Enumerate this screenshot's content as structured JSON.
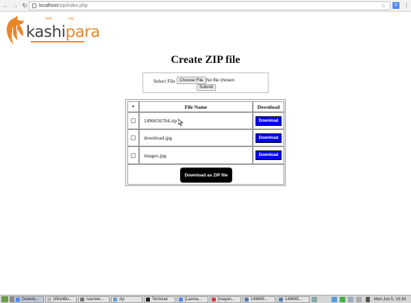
{
  "browser": {
    "url_host": "localhost",
    "url_path": "/zip/index.php"
  },
  "logo": {
    "text_main": "kashi",
    "text_accent": "para",
    "devanagari_1": "काशी",
    "devanagari_2": "पारा"
  },
  "page": {
    "title": "Create ZIP file"
  },
  "upload": {
    "label": "Select File",
    "choose_label": "Choose File",
    "no_file": "No file chosen",
    "submit_label": "Submit"
  },
  "table": {
    "headers": [
      "*",
      "File Name",
      "Download"
    ],
    "rows": [
      {
        "name": "1496656784.zip",
        "button": "Download"
      },
      {
        "name": "download.jpg",
        "button": "Download"
      },
      {
        "name": "images.jpg",
        "button": "Download"
      }
    ],
    "zip_button": "Download as ZIP file"
  },
  "taskbar": {
    "items": [
      "Downlo...",
      "[WishBo...",
      "/var/ww...",
      "zip",
      "Terminal",
      "[Laxma...",
      "[mayan...",
      "149665...",
      "149665..."
    ],
    "clock": "Mon Jun  5, 15:34"
  },
  "colors": {
    "brand_orange": "#e8862a",
    "download_blue": "#0000ee"
  }
}
